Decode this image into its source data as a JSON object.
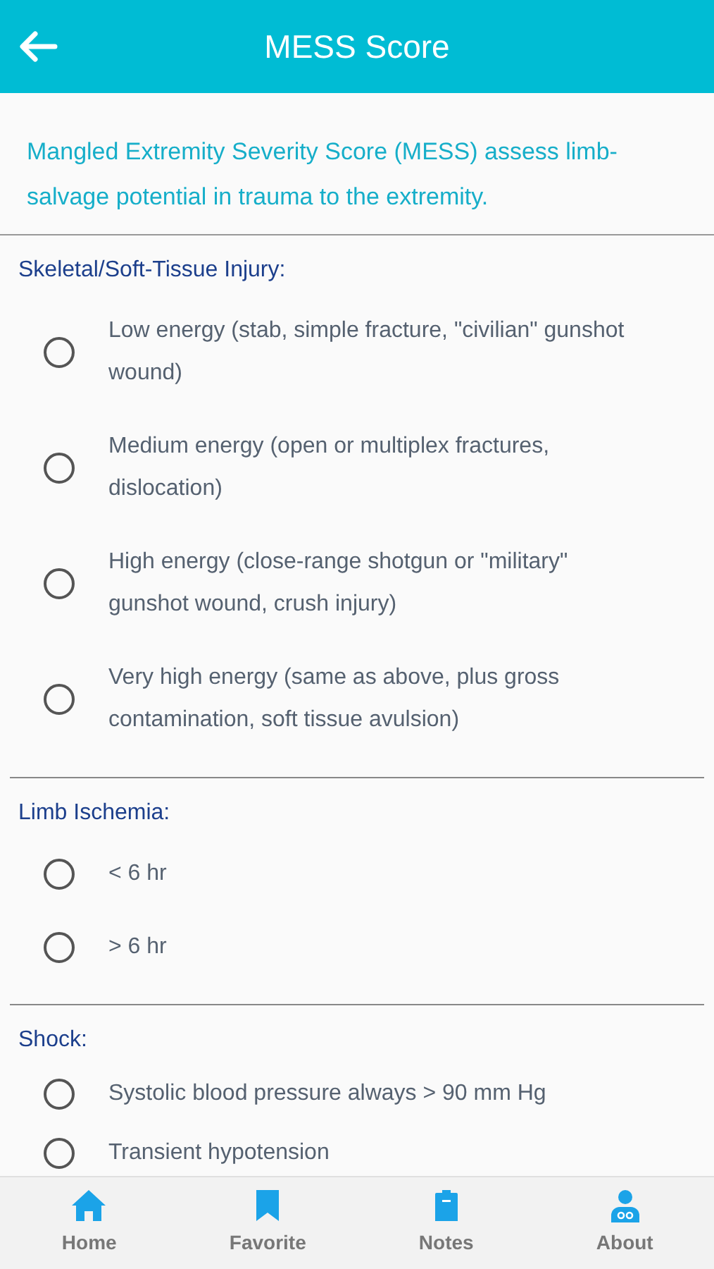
{
  "header": {
    "title": "MESS Score"
  },
  "intro": "Mangled Extremity Severity Score (MESS) assess limb-salvage potential in trauma to the extremity.",
  "sections": [
    {
      "title": "Skeletal/Soft-Tissue Injury:",
      "options": [
        {
          "label": "Low energy (stab, simple fracture, \"civilian\" gunshot wound)",
          "selected": false
        },
        {
          "label": "Medium energy (open or multiplex fractures, dislocation)",
          "selected": false
        },
        {
          "label": "High energy (close-range shotgun or \"military\" gunshot wound, crush injury)",
          "selected": false
        },
        {
          "label": "Very high energy (same as above, plus gross contamination, soft tissue avulsion)",
          "selected": false
        }
      ]
    },
    {
      "title": "Limb Ischemia:",
      "options": [
        {
          "label": "< 6 hr",
          "selected": false
        },
        {
          "label": "> 6 hr",
          "selected": false
        }
      ]
    },
    {
      "title": "Shock:",
      "options": [
        {
          "label": "Systolic blood pressure always > 90 mm Hg",
          "selected": false
        },
        {
          "label": "Transient hypotension",
          "selected": false
        }
      ]
    }
  ],
  "nav": [
    {
      "label": "Home",
      "kind": "home"
    },
    {
      "label": "Favorite",
      "kind": "favorite"
    },
    {
      "label": "Notes",
      "kind": "notes"
    },
    {
      "label": "About",
      "kind": "about"
    }
  ]
}
